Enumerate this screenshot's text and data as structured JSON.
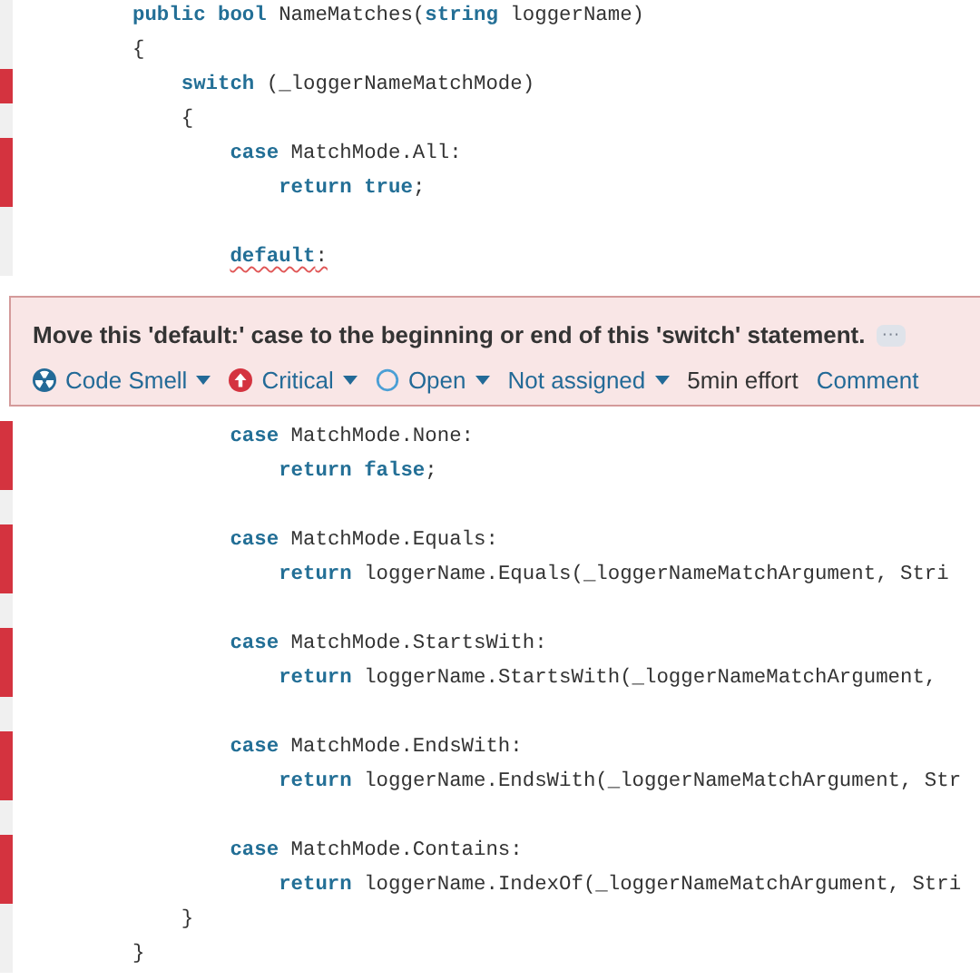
{
  "code_above": [
    {
      "marked": false,
      "tokens": [
        {
          "kind": "keyword",
          "text": "public bool"
        },
        {
          "kind": "plain",
          "text": " NameMatches("
        },
        {
          "kind": "keyword",
          "text": "string"
        },
        {
          "kind": "plain",
          "text": " loggerName)"
        }
      ]
    },
    {
      "marked": false,
      "tokens": [
        {
          "kind": "plain",
          "text": "{"
        }
      ]
    },
    {
      "marked": true,
      "tokens": [
        {
          "kind": "keyword",
          "text": "    switch"
        },
        {
          "kind": "plain",
          "text": " (_loggerNameMatchMode)"
        }
      ]
    },
    {
      "marked": false,
      "tokens": [
        {
          "kind": "plain",
          "text": "    {"
        }
      ]
    },
    {
      "marked": true,
      "tokens": [
        {
          "kind": "keyword",
          "text": "        case"
        },
        {
          "kind": "plain",
          "text": " MatchMode.All:"
        }
      ]
    },
    {
      "marked": true,
      "tokens": [
        {
          "kind": "keyword",
          "text": "            return true"
        },
        {
          "kind": "plain",
          "text": ";"
        }
      ]
    },
    {
      "marked": false
    },
    {
      "marked": false,
      "tokens": [
        {
          "kind": "keyword",
          "text": "        default",
          "flagged": true
        },
        {
          "kind": "plain",
          "text": ":",
          "flagged": true
        }
      ]
    }
  ],
  "issue": {
    "message": "Move this 'default:' case to the beginning or end of this 'switch' statement.",
    "more": "···",
    "attributes": [
      {
        "kind": "type",
        "label": "Code Smell",
        "dropdown": true
      },
      {
        "kind": "severity",
        "label": "Critical",
        "dropdown": true
      },
      {
        "kind": "status",
        "label": "Open",
        "dropdown": true
      },
      {
        "kind": "assignee",
        "label": "Not assigned",
        "dropdown": true
      },
      {
        "kind": "effort",
        "label": "5min effort",
        "dropdown": false
      },
      {
        "kind": "link",
        "label": "Comment",
        "dropdown": false
      }
    ]
  },
  "code_below": [
    {
      "marked": true,
      "tokens": [
        {
          "kind": "keyword",
          "text": "        case"
        },
        {
          "kind": "plain",
          "text": " MatchMode.None:"
        }
      ]
    },
    {
      "marked": true,
      "tokens": [
        {
          "kind": "keyword",
          "text": "            return false"
        },
        {
          "kind": "plain",
          "text": ";"
        }
      ]
    },
    {
      "marked": false
    },
    {
      "marked": true,
      "tokens": [
        {
          "kind": "keyword",
          "text": "        case"
        },
        {
          "kind": "plain",
          "text": " MatchMode.Equals:"
        }
      ]
    },
    {
      "marked": true,
      "tokens": [
        {
          "kind": "keyword",
          "text": "            return"
        },
        {
          "kind": "plain",
          "text": " loggerName.Equals(_loggerNameMatchArgument, Stri"
        }
      ]
    },
    {
      "marked": false
    },
    {
      "marked": true,
      "tokens": [
        {
          "kind": "keyword",
          "text": "        case"
        },
        {
          "kind": "plain",
          "text": " MatchMode.StartsWith:"
        }
      ]
    },
    {
      "marked": true,
      "tokens": [
        {
          "kind": "keyword",
          "text": "            return"
        },
        {
          "kind": "plain",
          "text": " loggerName.StartsWith(_loggerNameMatchArgument,"
        }
      ]
    },
    {
      "marked": false
    },
    {
      "marked": true,
      "tokens": [
        {
          "kind": "keyword",
          "text": "        case"
        },
        {
          "kind": "plain",
          "text": " MatchMode.EndsWith:"
        }
      ]
    },
    {
      "marked": true,
      "tokens": [
        {
          "kind": "keyword",
          "text": "            return"
        },
        {
          "kind": "plain",
          "text": " loggerName.EndsWith(_loggerNameMatchArgument, Str"
        }
      ]
    },
    {
      "marked": false
    },
    {
      "marked": true,
      "tokens": [
        {
          "kind": "keyword",
          "text": "        case"
        },
        {
          "kind": "plain",
          "text": " MatchMode.Contains:"
        }
      ]
    },
    {
      "marked": true,
      "tokens": [
        {
          "kind": "keyword",
          "text": "            return"
        },
        {
          "kind": "plain",
          "text": " loggerName.IndexOf(_loggerNameMatchArgument, Stri"
        }
      ]
    },
    {
      "marked": false,
      "tokens": [
        {
          "kind": "plain",
          "text": "    }"
        }
      ]
    },
    {
      "marked": false,
      "tokens": [
        {
          "kind": "plain",
          "text": "}"
        }
      ]
    }
  ]
}
